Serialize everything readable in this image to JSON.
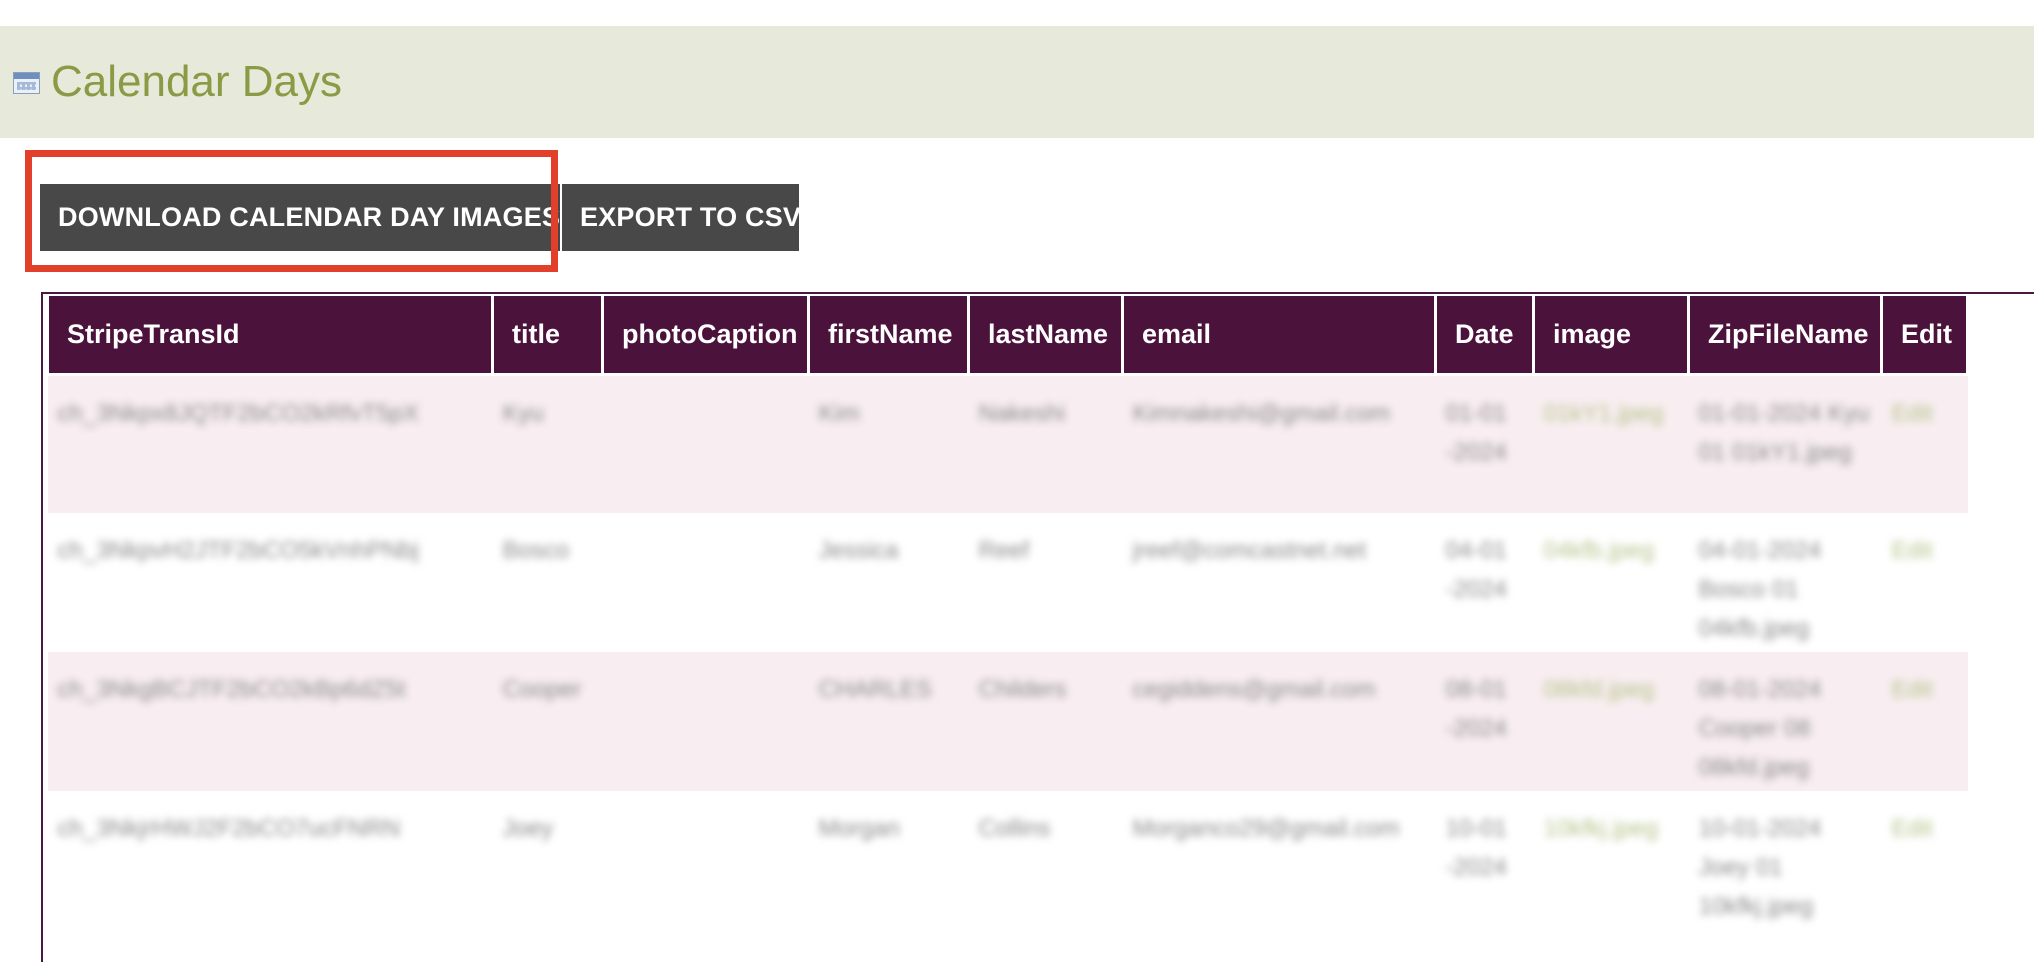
{
  "page": {
    "title": "Calendar Days",
    "title_icon": "calendar-icon"
  },
  "toolbar": {
    "download_label": "DOWNLOAD CALENDAR DAY IMAGES",
    "export_label": "EXPORT TO CSV",
    "highlight_color": "#e2402a",
    "button_color": "#484848"
  },
  "colors": {
    "header_band": "#e7e9da",
    "title": "#8a9a45",
    "table_header": "#4b123c",
    "row_alt": "#f8eef1"
  },
  "table": {
    "columns": [
      "StripeTransId",
      "title",
      "photoCaption",
      "firstName",
      "lastName",
      "email",
      "Date",
      "image",
      "ZipFileName",
      "Edit"
    ],
    "rows": [
      {
        "stripe": "ch_3Nkpx8JQTF2bCO2kRfvT5pX",
        "title": "Kyu",
        "caption": "",
        "first": "Kim",
        "last": "Nakeshi",
        "email": "Kimnakeshi@gmail.com",
        "date": "01-01-2024",
        "image": "01kY1.jpeg",
        "zip": "01-01-2024 Kyu 01 01kY1.jpeg",
        "edit": "Edit"
      },
      {
        "stripe": "ch_3NkpvH2JTF2bCO5kVnhPNbj",
        "title": "Bosco",
        "caption": "",
        "first": "Jessica",
        "last": "Reef",
        "email": "jreef@comcastnet.net",
        "date": "04-01-2024",
        "image": "04kfb.jpeg",
        "zip": "04-01-2024 Bosco 01 04kfb.jpeg",
        "edit": "Edit"
      },
      {
        "stripe": "ch_3NkgBCJTF2bCO2kBp6dZ5t",
        "title": "Cooper",
        "caption": "",
        "first": "CHARLES",
        "last": "Childers",
        "email": "cegiddens@gmail.com",
        "date": "08-01-2024",
        "image": "08kfd.jpeg",
        "zip": "08-01-2024 Cooper 08 08kfd.jpeg",
        "edit": "Edit"
      },
      {
        "stripe": "ch_3NkjrHWJ2F2bCO7ucFNRN",
        "title": "Joey",
        "caption": "",
        "first": "Morgan",
        "last": "Collins",
        "email": "Morganco29@gmail.com",
        "date": "10-01-2024",
        "image": "10kfkj.jpeg",
        "zip": "10-01-2024 Joey 01 10kfkj.jpeg",
        "edit": "Edit"
      }
    ]
  }
}
